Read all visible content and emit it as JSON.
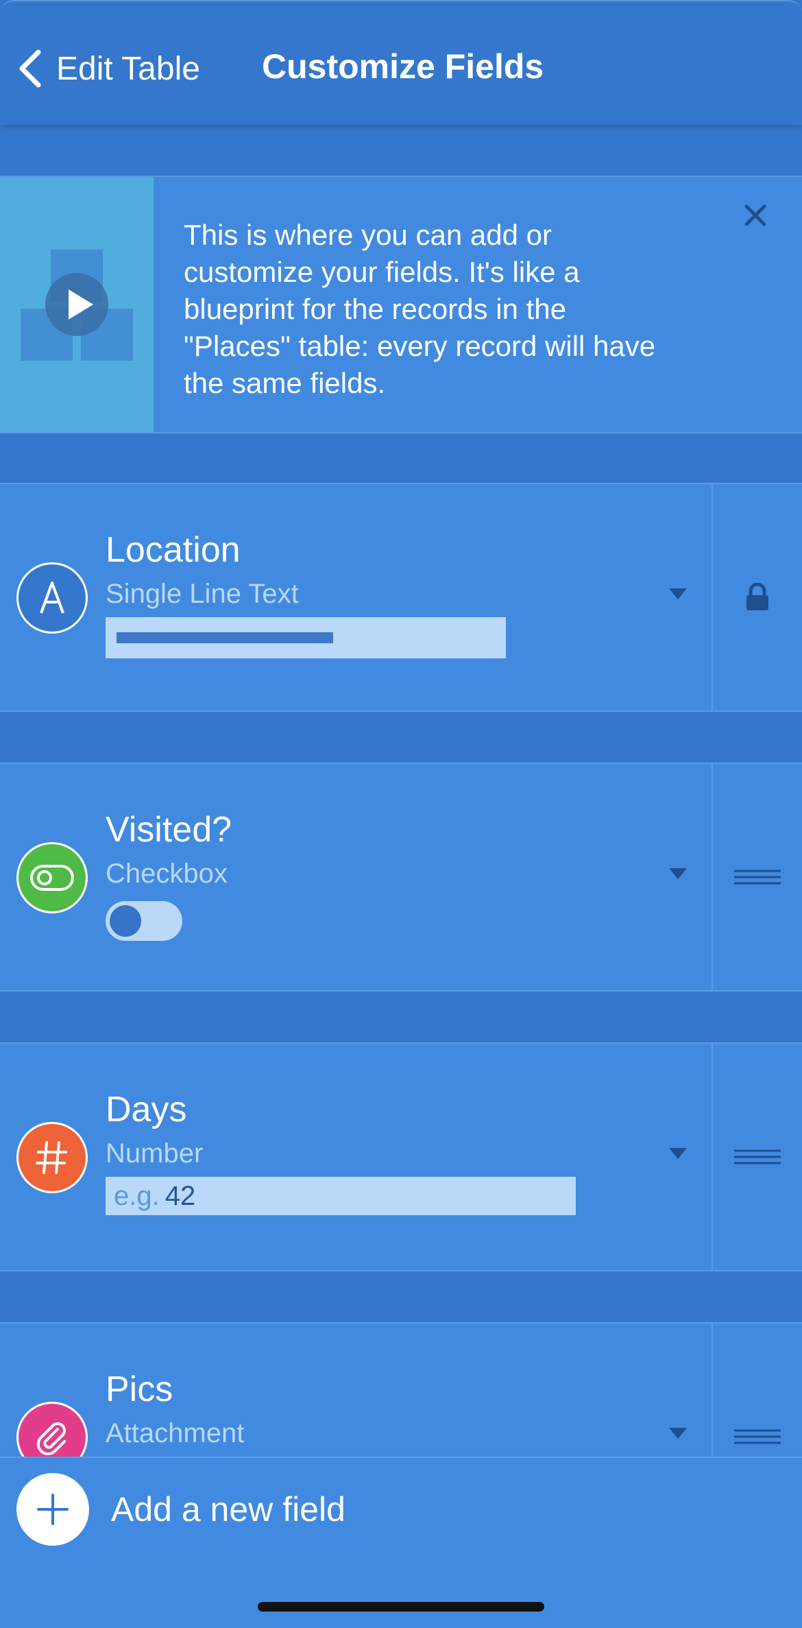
{
  "colors": {
    "background": "#3577cc",
    "card": "#418ae0",
    "preview": "#bad9f8",
    "location_icon": "#3577cc",
    "checkbox_icon": "#4fbb46",
    "number_icon": "#ee6337",
    "attachment_icon": "#e23d8a"
  },
  "nav": {
    "back_label": "Edit Table",
    "title": "Customize Fields",
    "back_icon": "chevron-left-icon"
  },
  "banner": {
    "text": "This is where you can add or customize your fields. It's like a blueprint for the records in the \"Places\" table: every record will have the same fields.",
    "thumb_icon": "play-icon",
    "close_icon": "close-icon"
  },
  "fields": [
    {
      "name": "Location",
      "type": "Single Line Text",
      "icon": "text-a-icon",
      "side_icon": "lock-icon"
    },
    {
      "name": "Visited?",
      "type": "Checkbox",
      "icon": "toggle-icon",
      "side_icon": "drag-handle-icon"
    },
    {
      "name": "Days",
      "type": "Number",
      "icon": "hash-icon",
      "side_icon": "drag-handle-icon",
      "placeholder": "e.g.",
      "sample_value": "42"
    },
    {
      "name": "Pics",
      "type": "Attachment",
      "icon": "paperclip-icon",
      "side_icon": "drag-handle-icon"
    }
  ],
  "add_field": {
    "label": "Add a new field",
    "icon": "plus-icon"
  }
}
